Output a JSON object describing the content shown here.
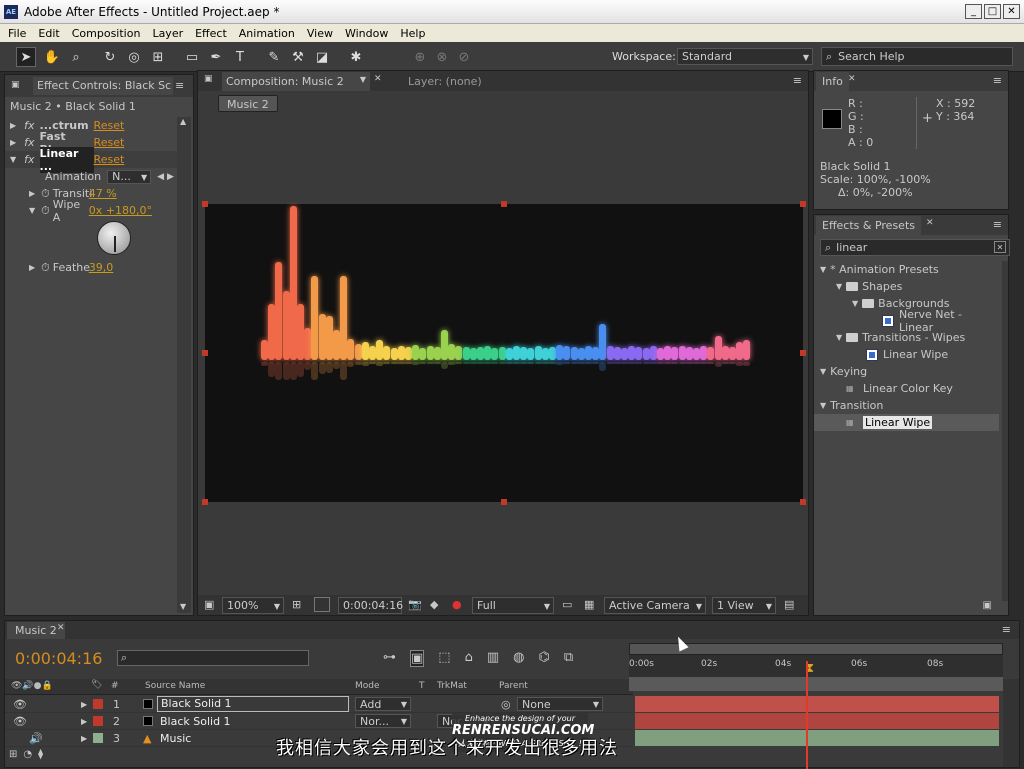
{
  "app": {
    "title": "Adobe After Effects - Untitled Project.aep *",
    "icon_text": "AE"
  },
  "menu": [
    "File",
    "Edit",
    "Composition",
    "Layer",
    "Effect",
    "Animation",
    "View",
    "Window",
    "Help"
  ],
  "toolbar": {
    "workspace_label": "Workspace:",
    "workspace_value": "Standard",
    "search_placeholder": "Search Help"
  },
  "effect_controls": {
    "tab": "Effect Controls: Black Sc",
    "breadcrumb": "Music 2 • Black Solid 1",
    "effects": [
      {
        "name": "...ctrum",
        "reset": "Reset"
      },
      {
        "name": "Fast Blur",
        "reset": "Reset"
      },
      {
        "name": "Linear ...",
        "reset": "Reset"
      }
    ],
    "animation_label": "Animation",
    "animation_value": "N...",
    "props": [
      {
        "label": "Transiti",
        "value": "47 %"
      },
      {
        "label": "Wipe A",
        "value": "0x +180,0°"
      },
      {
        "label": "Feathe",
        "value": "39,0"
      }
    ]
  },
  "composition": {
    "tab": "Composition: Music 2",
    "layer_tab": "Layer: (none)",
    "comp_button": "Music 2",
    "bottom": {
      "zoom": "100%",
      "timecode": "0:00:04:16",
      "resolution": "Full",
      "camera": "Active Camera",
      "views": "1 View"
    }
  },
  "info": {
    "tab": "Info",
    "r": "R :",
    "g": "G :",
    "b": "B :",
    "a": "A : 0",
    "x": "X : 592",
    "y": "Y : 364",
    "layer": "Black Solid 1",
    "scale": "Scale: 100%, -100%",
    "delta": "Δ: 0%, -200%"
  },
  "effects_presets": {
    "tab": "Effects & Presets",
    "search": "linear",
    "items": [
      "* Animation Presets",
      "Shapes",
      "Backgrounds",
      "Nerve Net - Linear",
      "Transitions - Wipes",
      "Linear Wipe",
      "Keying",
      "Linear Color Key",
      "Transition",
      "Linear Wipe"
    ]
  },
  "timeline": {
    "tab": "Music 2",
    "timecode": "0:00:04:16",
    "columns": {
      "source": "Source Name",
      "mode": "Mode",
      "t": "T",
      "trkmat": "TrkMat",
      "parent": "Parent"
    },
    "layers": [
      {
        "num": "1",
        "name": "Black Solid 1",
        "mode": "Add",
        "trkmat": "",
        "parent": "None",
        "color": "#c0392b"
      },
      {
        "num": "2",
        "name": "Black Solid 1",
        "mode": "Nor...",
        "trkmat": "Nor...",
        "parent": "",
        "color": "#c0392b"
      },
      {
        "num": "3",
        "name": "Music",
        "mode": "",
        "trkmat": "",
        "parent": "",
        "color": "#8fb08f"
      }
    ],
    "ruler": [
      "0:00s",
      "02s",
      "04s",
      "06s",
      "08s"
    ]
  },
  "overlay": {
    "subtitle": "我相信大家会用到这个来开发出很多用法",
    "watermark_top": "Enhance the design of your",
    "watermark_main": "RENRENSUCAI.COM",
    "watermark_bottom": "人人素材 · WITH A GREAT SITE !"
  },
  "audio_bars": {
    "colors": [
      "#f06a4a",
      "#f39a4a",
      "#f5d14e",
      "#9ad14f",
      "#3ccf8a",
      "#3fd2d8",
      "#4a8ff0",
      "#8a6af0",
      "#e06ad8",
      "#f06a8a"
    ],
    "heights": [
      14,
      50,
      92,
      63,
      148,
      50,
      26,
      78,
      40,
      38,
      24,
      78,
      15,
      10,
      12,
      8,
      14,
      8,
      6,
      8,
      7,
      9,
      6,
      8,
      7,
      24,
      10,
      8,
      7,
      6,
      7,
      8,
      6,
      7,
      6,
      8,
      7,
      6,
      8,
      6,
      7,
      9,
      8,
      7,
      6,
      8,
      7,
      30,
      8,
      7,
      6,
      8,
      7,
      6,
      8,
      6,
      8,
      7,
      8,
      7,
      6,
      8,
      7,
      18,
      8,
      7,
      12,
      14
    ]
  }
}
